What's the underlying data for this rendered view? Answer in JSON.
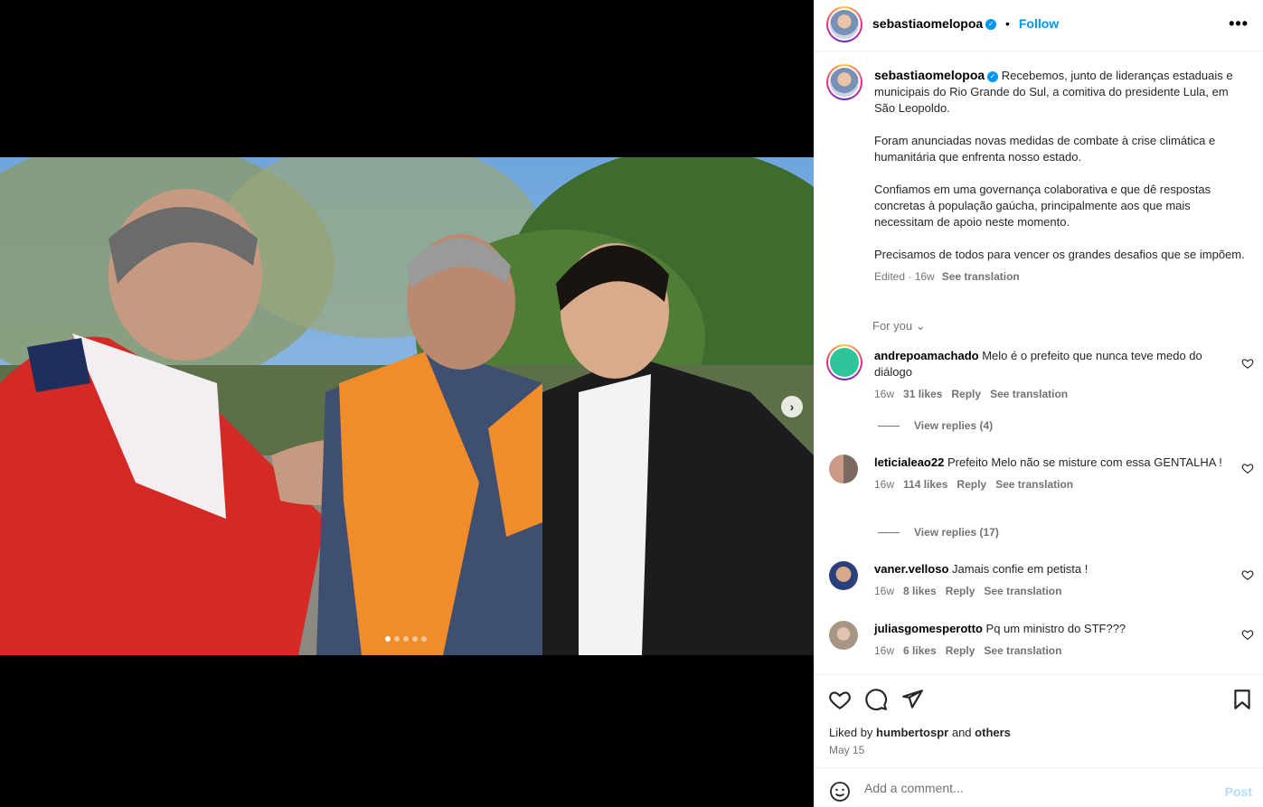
{
  "post": {
    "username": "sebastiaomelopoa",
    "follow_label": "Follow",
    "more_label": "•••",
    "caption_paragraphs": [
      "Recebemos, junto de lideranças estaduais e municipais do Rio Grande do Sul, a comitiva do presidente Lula, em São Leopoldo.",
      "Foram anunciadas novas medidas de combate à crise climática e humanitária que enfrenta nosso estado.",
      "Confiamos em uma governança colaborativa e que dê respostas concretas à população gaúcha, principalmente aos que mais necessitam de apoio neste momento.",
      "Precisamos de todos para vencer os grandes desafios que se impõem."
    ],
    "caption_meta": "Edited · 16w",
    "see_translation": "See translation",
    "for_you": "For you",
    "carousel": {
      "slides": 5,
      "active": 0
    }
  },
  "comments": [
    {
      "username": "andrepoamachado",
      "text": "Melo é o prefeito que nunca teve medo do diálogo",
      "age": "16w",
      "likes": "31 likes",
      "reply": "Reply",
      "translate": "See translation",
      "replies": "View replies (4)"
    },
    {
      "username": "leticialeao22",
      "text": "Prefeito Melo não se misture com essa GENTALHA !",
      "age": "16w",
      "likes": "114 likes",
      "reply": "Reply",
      "translate": "See translation",
      "replies": "View replies (17)"
    },
    {
      "username": "vaner.velloso",
      "text": "Jamais confie em petista !",
      "age": "16w",
      "likes": "8 likes",
      "reply": "Reply",
      "translate": "See translation"
    },
    {
      "username": "juliasgomesperotto",
      "text": "Pq um ministro do STF???",
      "age": "16w",
      "likes": "6 likes",
      "reply": "Reply",
      "translate": "See translation"
    }
  ],
  "footer": {
    "liked_prefix": "Liked by",
    "liked_user": "humbertospr",
    "liked_and": "and",
    "liked_others": "others",
    "date": "May 15",
    "comment_placeholder": "Add a comment...",
    "post_label": "Post"
  },
  "colors": {
    "accent": "#0095f6",
    "muted": "#737373",
    "text": "#262626"
  }
}
